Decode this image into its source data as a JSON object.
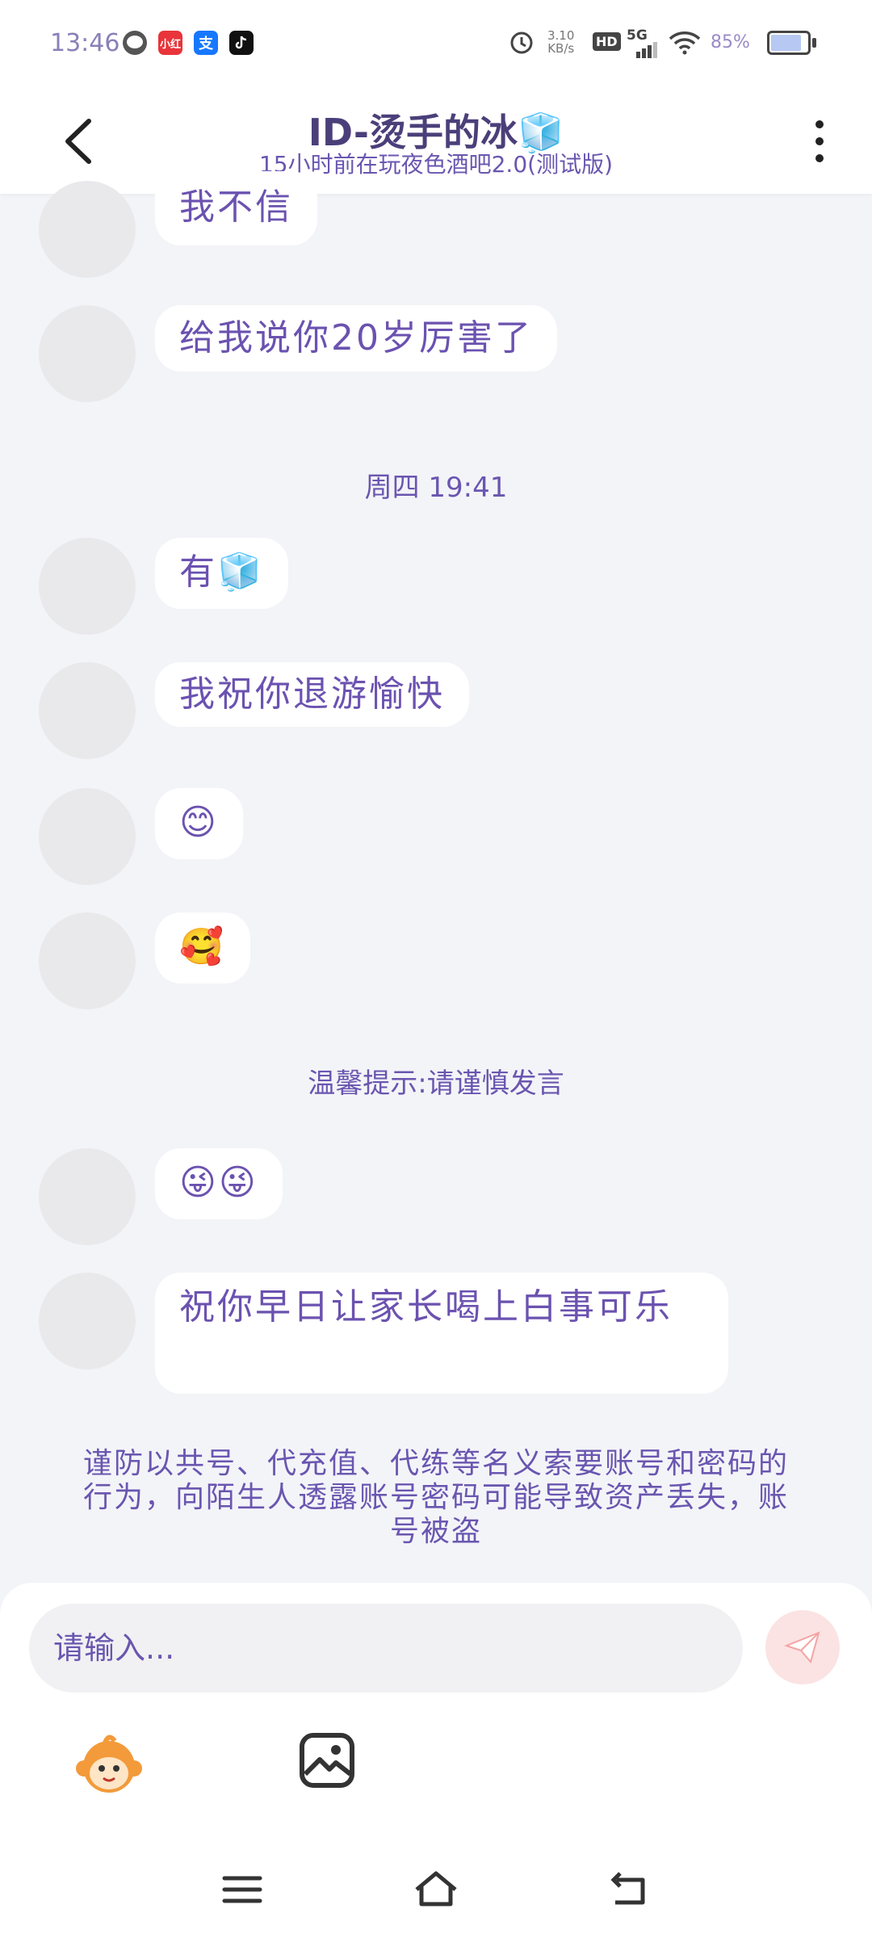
{
  "status_bar": {
    "time": "13:46",
    "apps": [
      "message-icon",
      "xiaohongshu-icon",
      "alipay-icon",
      "tiktok-icon"
    ],
    "net_speed": "3.10",
    "net_unit": "KB/s",
    "hd": "HD",
    "signal": "5G",
    "battery": "85%",
    "battery_level": 0.85
  },
  "header": {
    "title": "ID-烫手的冰🧊",
    "subtitle": "15小时前在玩夜色酒吧2.0(测试版)"
  },
  "messages": [
    {
      "text": "我不信"
    },
    {
      "text": "给我说你20岁厉害了"
    },
    {
      "text": "有🧊"
    },
    {
      "text": "我祝你退游愉快"
    },
    {
      "text": "😊"
    },
    {
      "text": "🥰"
    },
    {
      "text": "😜😜"
    },
    {
      "text": "祝你早日让家长喝上白事可乐"
    }
  ],
  "time_divider": "周四 19:41",
  "tip": "温馨提示:请谨慎发言",
  "warning": "谨防以共号、代充值、代练等名义索要账号和密码的行为，向陌生人透露账号密码可能导致资产丢失，账号被盗",
  "composer": {
    "placeholder": "请输入..."
  },
  "colors": {
    "accent": "#6a56b0",
    "background": "#f3f4f8",
    "send": "#f4a3a3"
  }
}
